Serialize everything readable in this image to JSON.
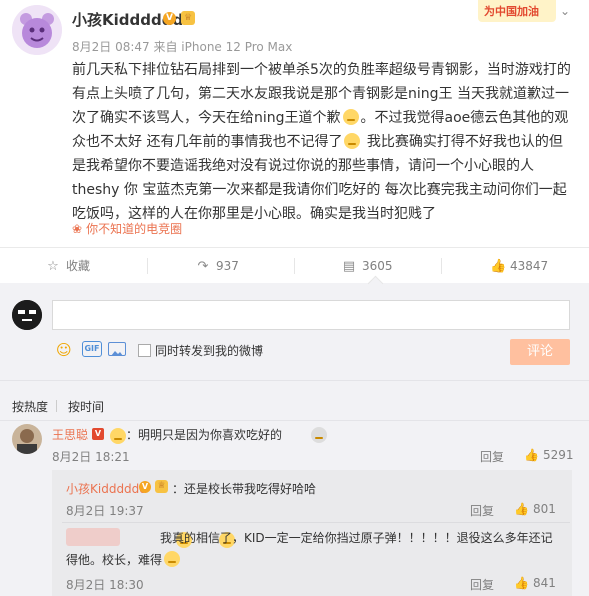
{
  "post": {
    "author": "小孩Kidddddd",
    "meta": "8月2日 08:47 来自 iPhone 12 Pro Max",
    "banner": "为中国加油",
    "lines": [
      "前几天私下排位钻石局排到一个被单杀5次的负胜率超级号青钢影，当时游戏打的",
      "有点上头喷了几句，第二天水友跟我说是那个青钢影是ning王 当天我就道歉过一",
      "次了确实不该骂人，今天在给ning王道个歉",
      "。不过我觉得aoe德云色其他的观",
      "众也不太好 还有几年前的事情我也不记得了",
      " 我比赛确实打得不好我也认的但",
      "是我希望你不要造谣我绝对没有说过你说的那些事情，请问一个小心眼的人",
      "theshy 你 宝蓝杰克第一次来都是我请你们吃好的 每次比赛完我主动问你们一起",
      "吃饭吗，这样的人在你那里是小心眼。确实是我当时犯贱了"
    ],
    "source": "你不知道的电竞圈"
  },
  "actions": {
    "collect": "收藏",
    "forward": "937",
    "comment": "3605",
    "like": "43847"
  },
  "composer": {
    "placeholder": "",
    "also_forward": "同时转发到我的微博",
    "submit": "评论",
    "gif": "GIF"
  },
  "sort": {
    "hot": "按热度",
    "time": "按时间"
  },
  "comments": [
    {
      "name": "王思聪",
      "text": "：明明只是因为你喜欢吃好的",
      "date": "8月2日 18:21",
      "reply": "回复",
      "likes": "5291"
    }
  ],
  "replies": [
    {
      "name": "小孩Kidddddd",
      "text": "：还是校长带我吃得好哈哈",
      "date": "8月2日 19:37",
      "reply": "回复",
      "likes": "801"
    },
    {
      "line1": "我真的相信了，KID一定一定给你挡过原子弹！！！！！退役这么多年还记",
      "line2": "得他。校长，难得",
      "date": "8月2日 18:30",
      "reply": "回复",
      "likes": "841"
    }
  ],
  "colors": {
    "accent": "#eb7350",
    "panel": "#f2f2f5",
    "submit": "#ffc09f",
    "badge": "#f5a623"
  }
}
